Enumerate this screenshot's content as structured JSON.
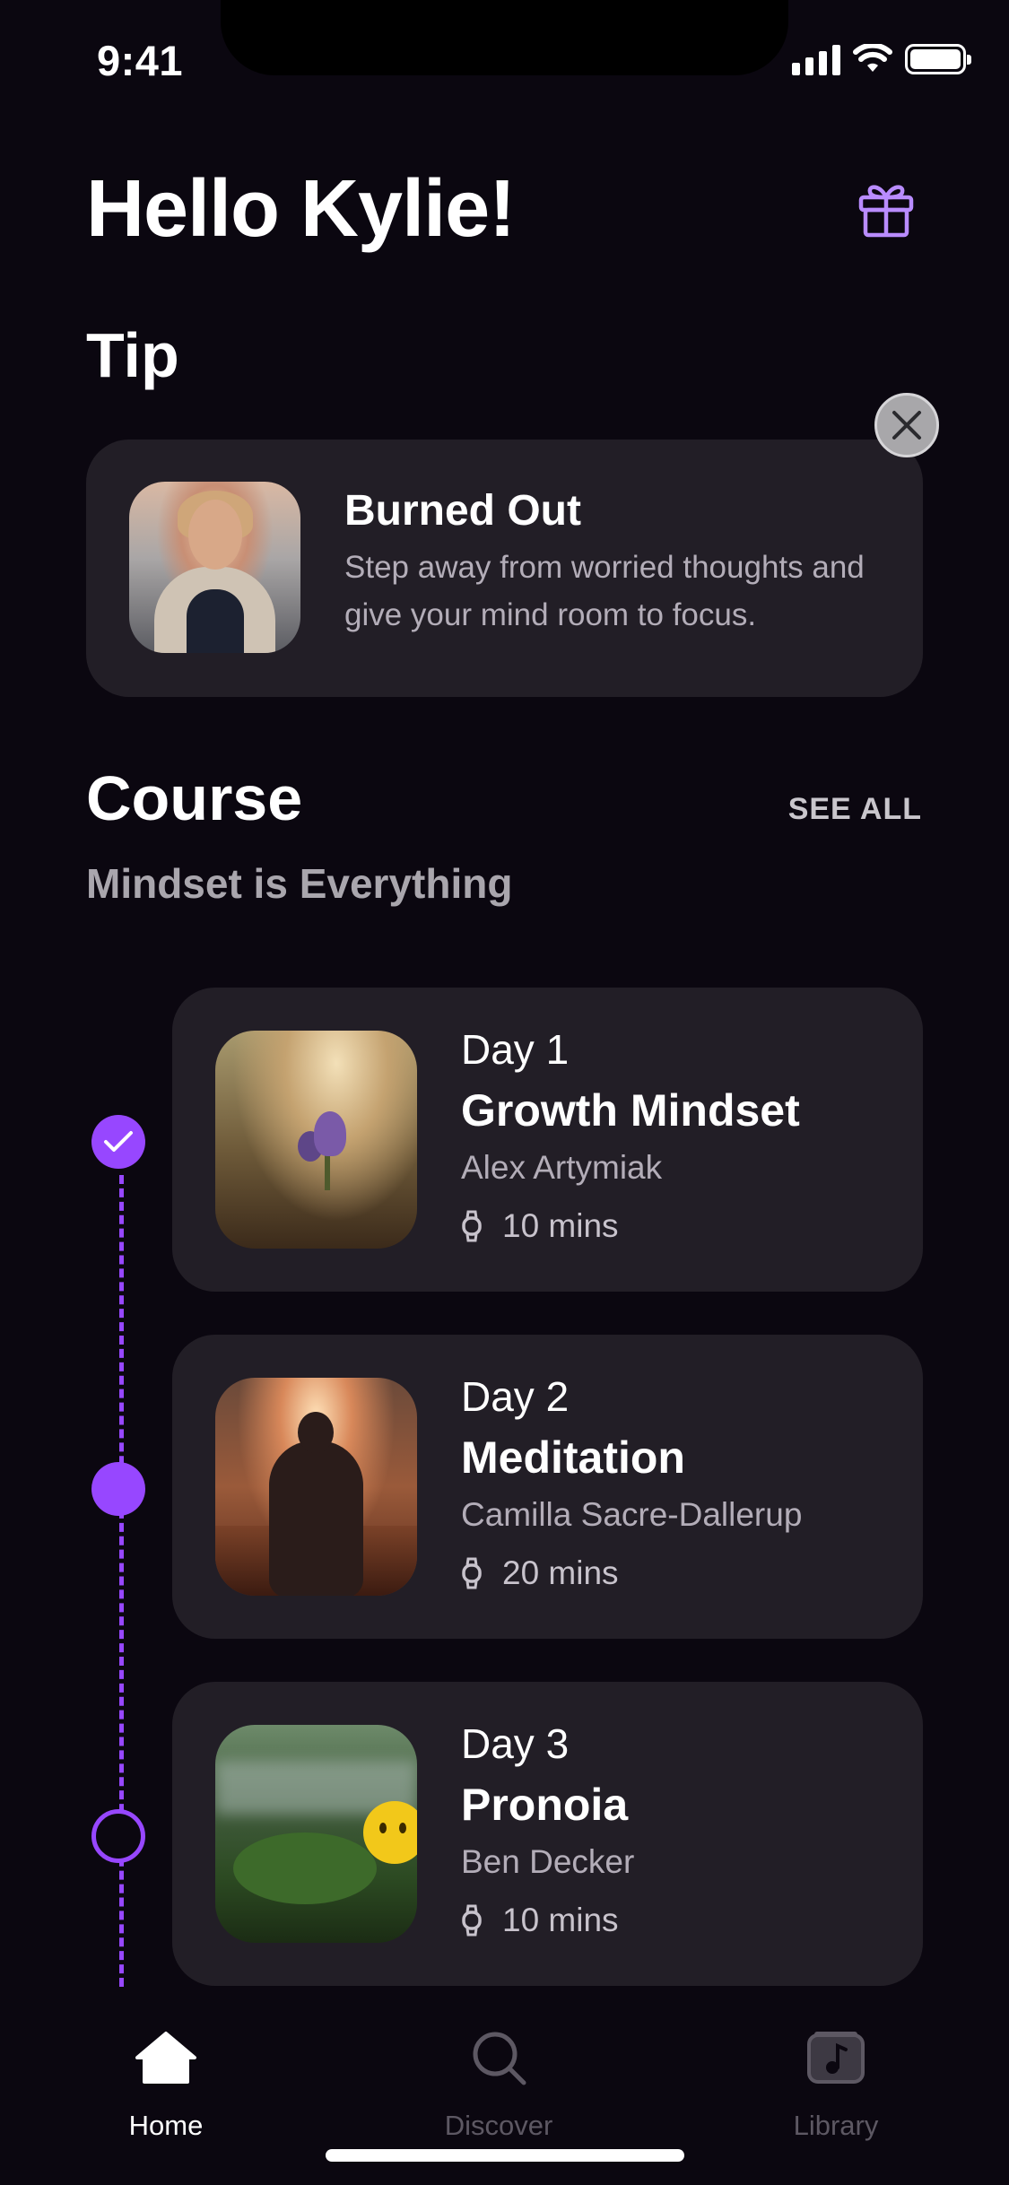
{
  "status_bar": {
    "time": "9:41"
  },
  "header": {
    "greeting": "Hello Kylie!"
  },
  "tip": {
    "heading": "Tip",
    "title": "Burned Out",
    "text": "Step away from worried thoughts and give your mind room to focus."
  },
  "course": {
    "heading": "Course",
    "see_all": "SEE ALL",
    "subtitle": "Mindset is Everything",
    "days": [
      {
        "label": "Day 1",
        "title": "Growth Mindset",
        "author": "Alex Artymiak",
        "duration": "10 mins",
        "status": "completed"
      },
      {
        "label": "Day 2",
        "title": "Meditation",
        "author": "Camilla Sacre-Dallerup",
        "duration": "20 mins",
        "status": "current"
      },
      {
        "label": "Day 3",
        "title": "Pronoia",
        "author": "Ben Decker",
        "duration": "10 mins",
        "status": "upcoming"
      }
    ]
  },
  "tabbar": {
    "tabs": [
      {
        "label": "Home",
        "icon": "home-icon",
        "active": true
      },
      {
        "label": "Discover",
        "icon": "search-icon",
        "active": false
      },
      {
        "label": "Library",
        "icon": "music-note-icon",
        "active": false
      }
    ]
  },
  "colors": {
    "background": "#0b0710",
    "card": "#221e26",
    "accent": "#9747ff",
    "muted_text": "#b3adb8"
  }
}
